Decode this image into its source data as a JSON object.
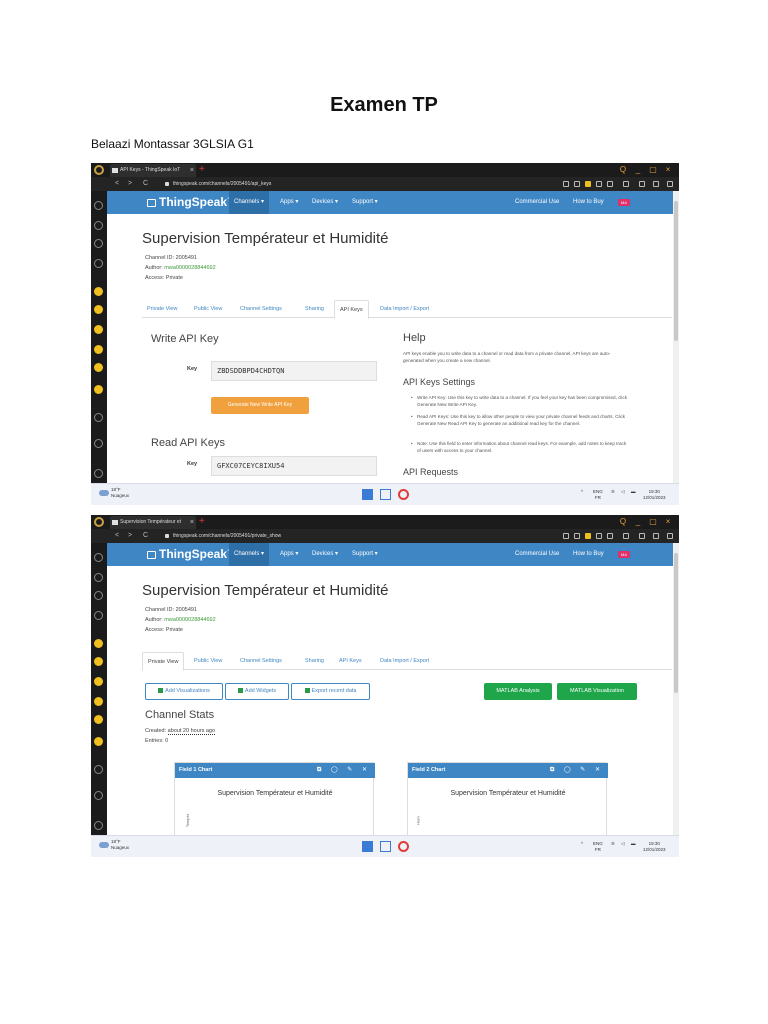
{
  "document": {
    "title": "Examen TP",
    "author_line": "Belaazi Montassar 3GLSIA G1"
  },
  "browser": {
    "new_tab_symbol": "+",
    "close_symbol": "×",
    "nav_back": "<",
    "nav_forward": ">",
    "nav_reload": "C",
    "window_controls": [
      "Q",
      "_",
      "▢",
      "×"
    ]
  },
  "site": {
    "logo_text": "ThingSpeak™",
    "nav_items": [
      "Channels ▾",
      "Apps ▾",
      "Devices ▾",
      "Support ▾"
    ],
    "nav_right": [
      "Commercial Use",
      "How to Buy"
    ],
    "user_badge": "MA"
  },
  "channel": {
    "title": "Supervision Températeur et Humidité",
    "channel_id_label": "Channel ID:",
    "channel_id": "2005491",
    "author_label": "Author:",
    "author": "mwa0000028844692",
    "access": "Access: Private",
    "tabs": [
      "Private View",
      "Public View",
      "Channel Settings",
      "Sharing",
      "API Keys",
      "Data Import / Export"
    ]
  },
  "shot1": {
    "tab_title": "API Keys - ThingSpeak IoT",
    "url": "thingspeak.com/channels/2005491/api_keys",
    "active_tab_index": 4,
    "write_heading": "Write API Key",
    "key_label": "Key",
    "write_key": "ZBDSDDBPD4CHDTQN",
    "generate_button": "Generate New Write API Key",
    "read_heading": "Read API Keys",
    "read_key": "GFXC07CEYC8IXU54",
    "help_heading": "Help",
    "help_text": "API keys enable you to write data to a channel or read data from a private channel. API keys are auto-generated when you create a new channel.",
    "settings_heading": "API Keys Settings",
    "settings_items": [
      "Write API Key: Use this key to write data to a channel. If you feel your key has been compromised, click Generate New Write API Key.",
      "Read API Keys: Use this key to allow other people to view your private channel feeds and charts. Click Generate New Read API Key to generate an additional read key for the channel.",
      "Note: Use this field to enter information about channel read keys. For example, add notes to keep track of users with access to your channel."
    ],
    "requests_heading": "API Requests"
  },
  "shot2": {
    "tab_title": "Supervision Températeur et",
    "url": "thingspeak.com/channels/2005491/private_show",
    "active_tab_index": 0,
    "buttons": [
      "Add Visualizations",
      "Add Widgets",
      "Export recent data"
    ],
    "green_buttons": [
      "MATLAB Analysis",
      "MATLAB Visualization"
    ],
    "stats_heading": "Channel Stats",
    "created_label": "Created:",
    "created_value": "about 20 hours ago",
    "entries": "Entries: 0",
    "charts": [
      {
        "header": "Field 1 Chart",
        "title": "Supervision Températeur et Humidité",
        "ylabel": "Tempér"
      },
      {
        "header": "Field 2 Chart",
        "title": "Supervision Températeur et Humidité",
        "ylabel": "Hum"
      }
    ]
  },
  "taskbar": {
    "weather_temp": "18°F",
    "weather_desc": "Nuageux",
    "lang": "ENG",
    "region": "FR",
    "time": "19:30",
    "date": "12/01/2023"
  },
  "colors": {
    "thingspeak_blue": "#3f86c4",
    "generate_orange": "#f0a03c",
    "matlab_green": "#1fa64a",
    "browser_dark": "#1b1b1b"
  }
}
